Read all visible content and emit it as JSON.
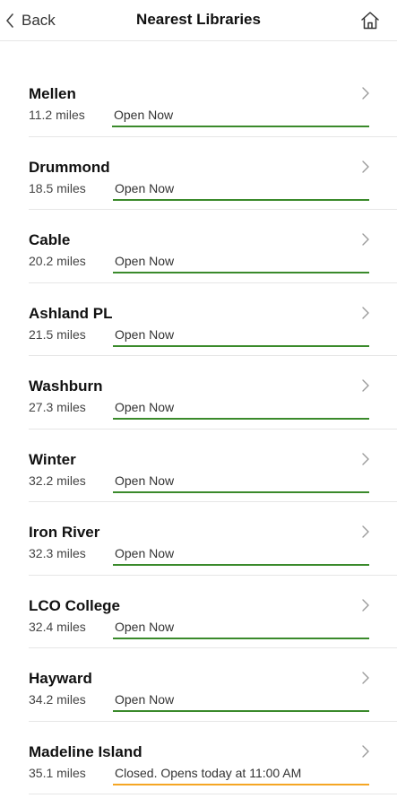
{
  "nav": {
    "back_label": "Back",
    "title": "Nearest Libraries"
  },
  "colors": {
    "open": "#3a8a2b",
    "closed": "#f5a623"
  },
  "libraries": [
    {
      "name": "Mellen",
      "distance": "11.2 miles",
      "status": "Open Now",
      "state": "open"
    },
    {
      "name": "Drummond",
      "distance": "18.5 miles",
      "status": "Open Now",
      "state": "open"
    },
    {
      "name": "Cable",
      "distance": "20.2 miles",
      "status": "Open Now",
      "state": "open"
    },
    {
      "name": "Ashland PL",
      "distance": "21.5 miles",
      "status": "Open Now",
      "state": "open"
    },
    {
      "name": "Washburn",
      "distance": "27.3 miles",
      "status": "Open Now",
      "state": "open"
    },
    {
      "name": "Winter",
      "distance": "32.2 miles",
      "status": "Open Now",
      "state": "open"
    },
    {
      "name": "Iron River",
      "distance": "32.3 miles",
      "status": "Open Now",
      "state": "open"
    },
    {
      "name": "LCO College",
      "distance": "32.4 miles",
      "status": "Open Now",
      "state": "open"
    },
    {
      "name": "Hayward",
      "distance": "34.2 miles",
      "status": "Open Now",
      "state": "open"
    },
    {
      "name": "Madeline Island",
      "distance": "35.1 miles",
      "status": "Closed. Opens today at 11:00 AM",
      "state": "closed"
    }
  ]
}
